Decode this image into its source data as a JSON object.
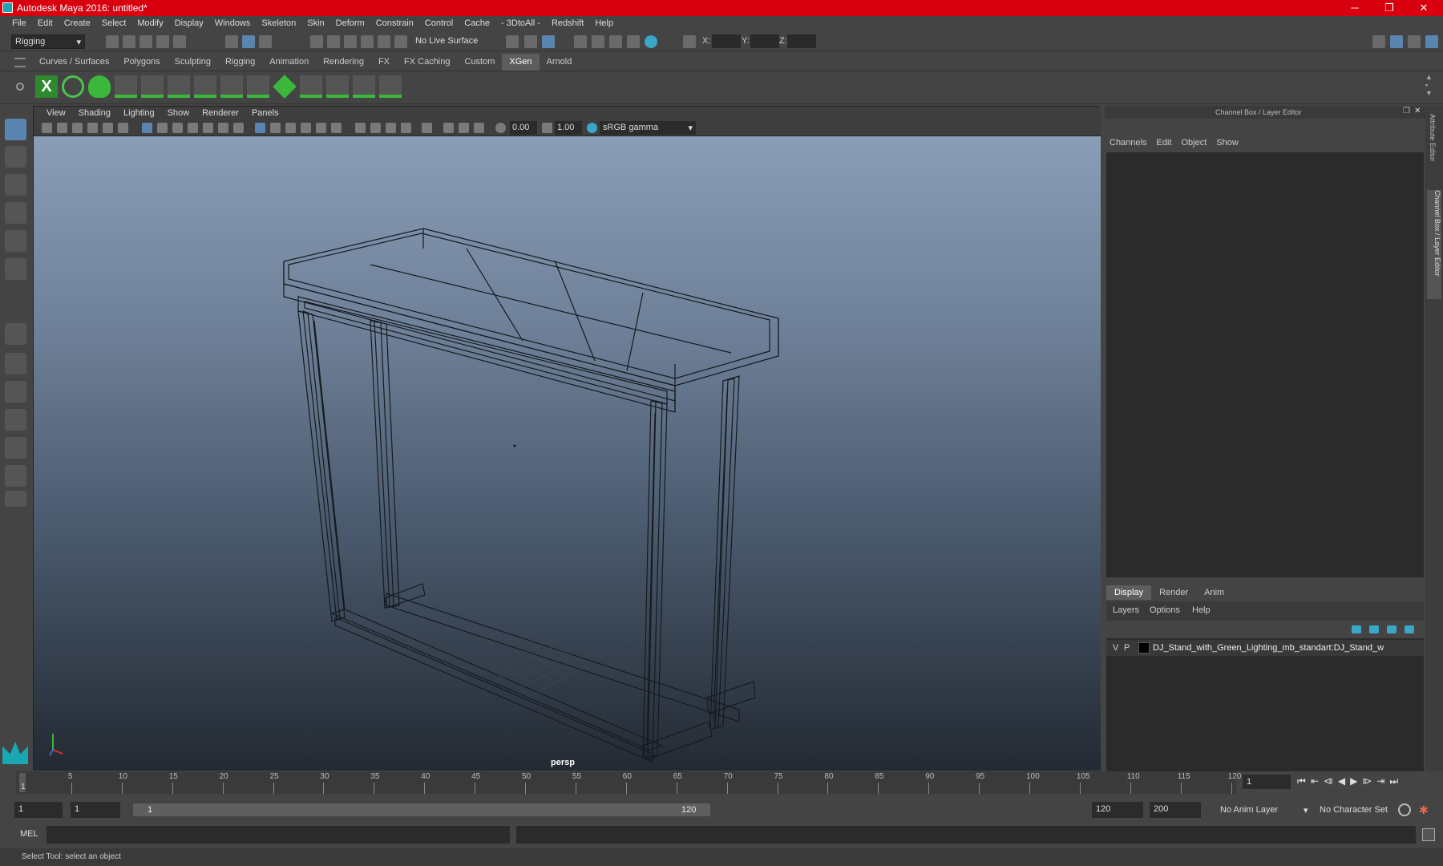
{
  "window": {
    "title": "Autodesk Maya 2016: untitled*"
  },
  "menubar": [
    "File",
    "Edit",
    "Create",
    "Select",
    "Modify",
    "Display",
    "Windows",
    "Skeleton",
    "Skin",
    "Deform",
    "Constrain",
    "Control",
    "Cache",
    "- 3DtoAll -",
    "Redshift",
    "Help"
  ],
  "toolbar": {
    "mode": "Rigging",
    "live_surface": "No Live Surface",
    "x_label": "X:",
    "y_label": "Y:",
    "z_label": "Z:"
  },
  "shelf_tabs": [
    "Curves / Surfaces",
    "Polygons",
    "Sculpting",
    "Rigging",
    "Animation",
    "Rendering",
    "FX",
    "FX Caching",
    "Custom",
    "XGen",
    "Arnold"
  ],
  "active_shelf": "XGen",
  "viewport": {
    "menu": [
      "View",
      "Shading",
      "Lighting",
      "Show",
      "Renderer",
      "Panels"
    ],
    "val1": "0.00",
    "val2": "1.00",
    "colorspace": "sRGB gamma",
    "camera": "persp"
  },
  "channel_box": {
    "title": "Channel Box / Layer Editor",
    "menu": [
      "Channels",
      "Edit",
      "Object",
      "Show"
    ]
  },
  "layer_editor": {
    "tabs": [
      "Display",
      "Render",
      "Anim"
    ],
    "menu": [
      "Layers",
      "Options",
      "Help"
    ],
    "layer": {
      "v": "V",
      "p": "P",
      "name": "DJ_Stand_with_Green_Lighting_mb_standart:DJ_Stand_w"
    }
  },
  "side_tabs": {
    "attr": "Attribute Editor",
    "cb": "Channel Box / Layer Editor"
  },
  "timeline": {
    "ticks": [
      "5",
      "10",
      "15",
      "20",
      "25",
      "30",
      "35",
      "40",
      "45",
      "50",
      "55",
      "60",
      "65",
      "70",
      "75",
      "80",
      "85",
      "90",
      "95",
      "100",
      "105",
      "110",
      "115",
      "120"
    ],
    "start_tick": "1",
    "current": "1"
  },
  "range": {
    "start": "1",
    "start2": "1",
    "range_start": "1",
    "range_end": "120",
    "end": "120",
    "end2": "200",
    "anim_layer": "No Anim Layer",
    "char_set": "No Character Set"
  },
  "mel": {
    "label": "MEL"
  },
  "status": "Select Tool: select an object"
}
